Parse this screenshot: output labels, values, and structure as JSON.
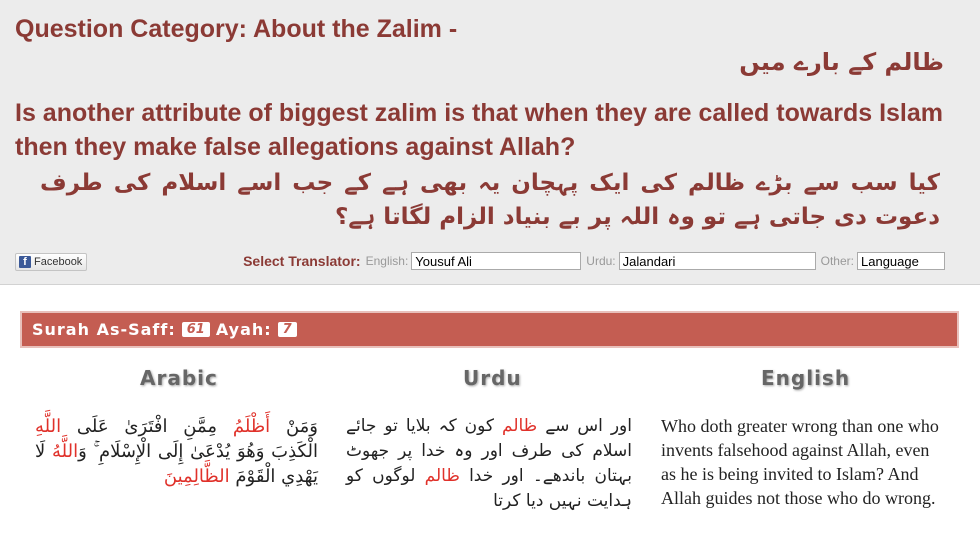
{
  "category": {
    "title": "Question Category: About the Zalim -",
    "urdu": "ظالم کے بارے میں"
  },
  "question": {
    "english": "Is another attribute of biggest zalim is that when they are called towards Islam then they make false allegations against Allah?",
    "urdu": "کیا سب سے بڑے ظالم کی ایک پہچان یہ بھی ہے کے جب اسے اسلام کی طرف دعوت دی جاتی ہے تو وہ اللہ پر بے بنیاد الزام لگاتا ہے؟"
  },
  "share": {
    "facebook_label": "Facebook"
  },
  "translator": {
    "label": "Select Translator:",
    "english_label": "English:",
    "english_value": "Yousuf Ali",
    "urdu_label": "Urdu:",
    "urdu_value": "Jalandari",
    "other_label": "Other:",
    "other_value": "Language"
  },
  "verse": {
    "surah_label": "Surah As-Saff:",
    "surah_number": "61",
    "ayah_label": "Ayah:",
    "ayah_number": "7"
  },
  "columns": {
    "arabic_heading": "Arabic",
    "urdu_heading": "Urdu",
    "english_heading": "English"
  },
  "arabic": {
    "part1": "وَمَنْ ",
    "highlight1": "أَظْلَمُ",
    "part2": " مِمَّنِ افْتَرَىٰ عَلَى ",
    "highlight2": "اللَّهِ",
    "part3": " الْكَذِبَ وَهُوَ يُدْعَىٰ إِلَى الْإِسْلَامِ ۚ وَ",
    "highlight3": "اللَّهُ",
    "part4": " لَا يَهْدِي الْقَوْمَ ",
    "highlight4": "الظَّالِمِينَ"
  },
  "urdu_translation": {
    "part1": "اور اس سے ",
    "highlight1": "ظالم",
    "part2": " کون کہ بلایا تو جائے اسلام کی طرف اور وہ خدا پر جھوٹ بہتان باندھے۔ اور خدا ",
    "highlight2": "ظالم",
    "part3": " لوگوں کو ہدایت نہیں دیا کرتا"
  },
  "english_translation": "Who doth greater wrong than one who invents falsehood against Allah, even as he is being invited to Islam? And Allah guides not those who do wrong.",
  "colors": {
    "title": "#8b3a35",
    "bar": "#c45d52",
    "highlight": "#e0312a"
  }
}
